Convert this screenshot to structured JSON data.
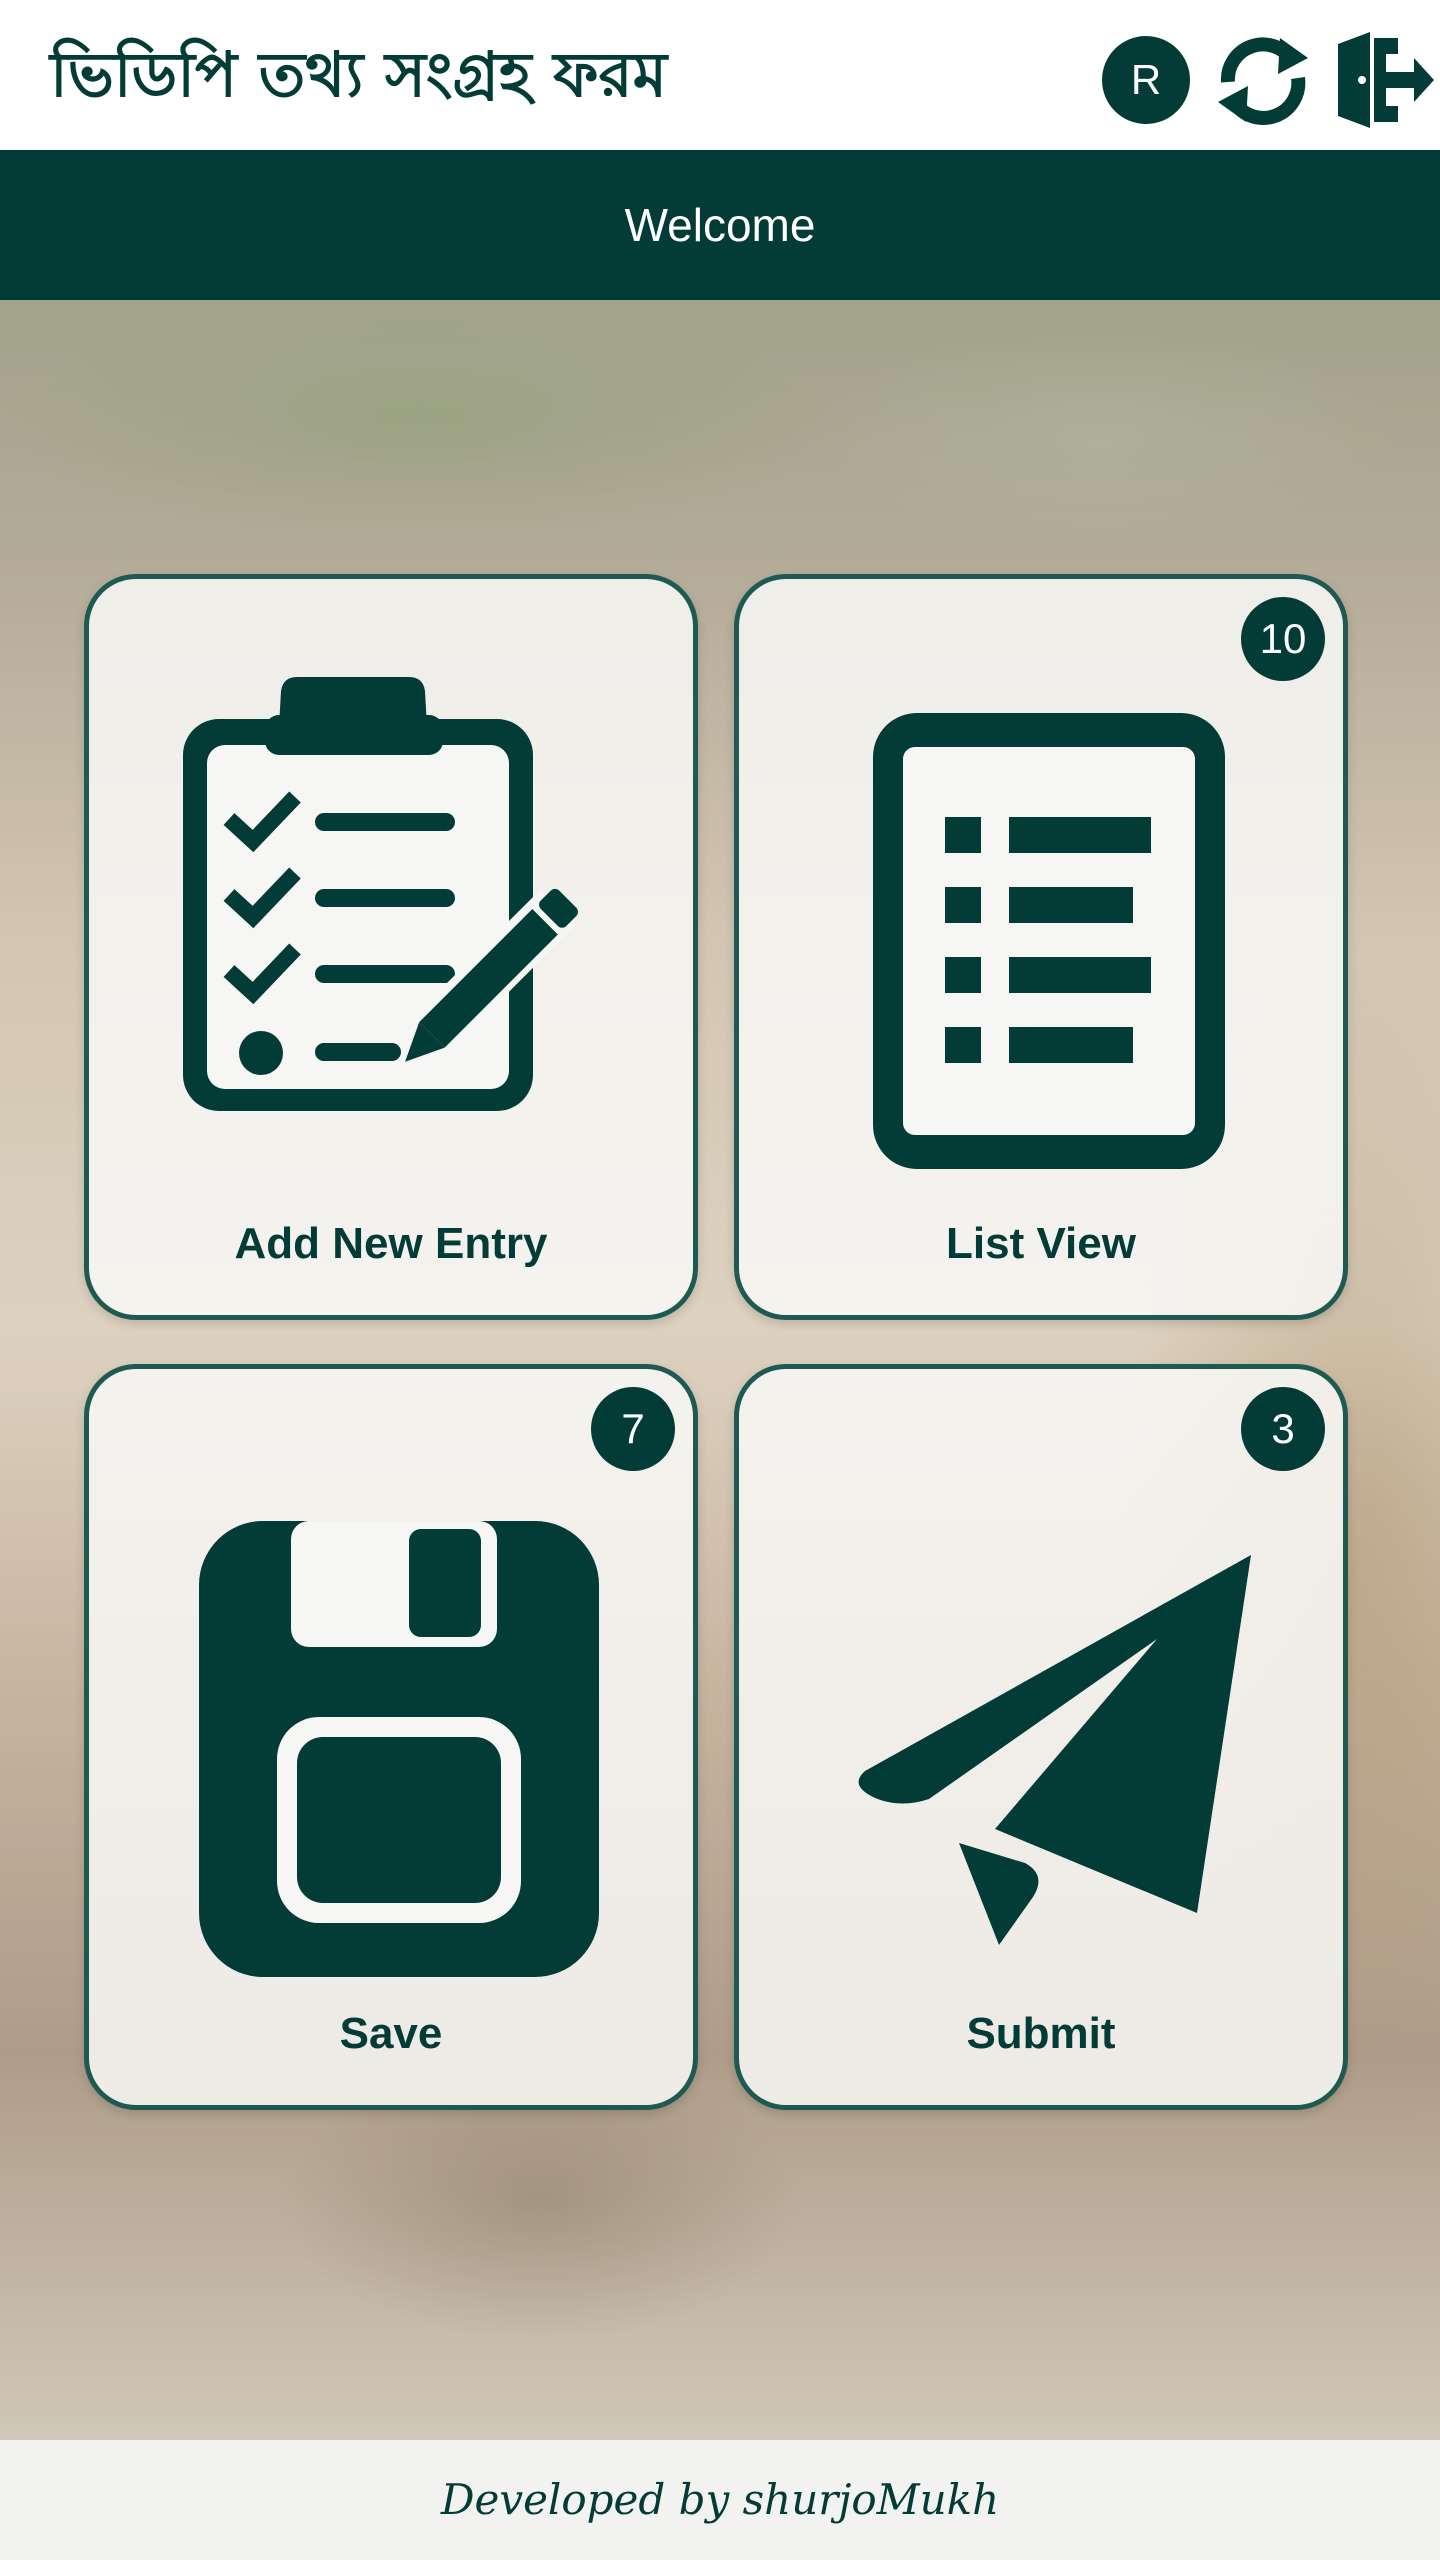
{
  "header": {
    "title": "ভিডিপি তথ্য সংগ্রহ ফরম",
    "avatar_letter": "R",
    "refresh_icon": "refresh-icon",
    "logout_icon": "logout-icon"
  },
  "welcome": {
    "text": "Welcome"
  },
  "tiles": {
    "add": {
      "label": "Add New Entry",
      "icon": "clipboard-checklist-icon"
    },
    "list": {
      "label": "List View",
      "icon": "list-document-icon",
      "badge": "10"
    },
    "save": {
      "label": "Save",
      "icon": "floppy-disk-icon",
      "badge": "7"
    },
    "submit": {
      "label": "Submit",
      "icon": "paper-plane-icon",
      "badge": "3"
    }
  },
  "footer": {
    "text": "Developed by shurjoMukh"
  },
  "colors": {
    "primary": "#033b36",
    "background": "#ffffff",
    "text_on_primary": "#ffffff"
  }
}
